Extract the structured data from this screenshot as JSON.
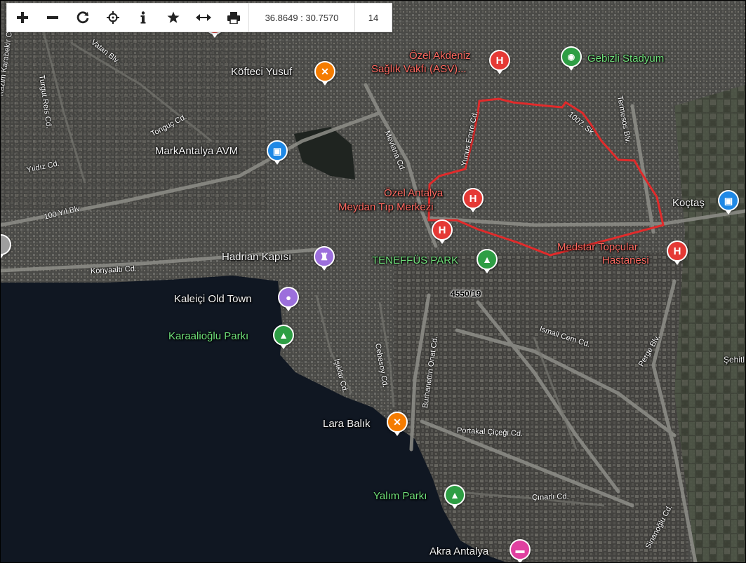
{
  "toolbar": {
    "buttons": [
      {
        "name": "zoom-in-button",
        "icon": "plus-icon"
      },
      {
        "name": "zoom-out-button",
        "icon": "minus-icon"
      },
      {
        "name": "refresh-button",
        "icon": "refresh-icon"
      },
      {
        "name": "locate-button",
        "icon": "crosshair-icon"
      },
      {
        "name": "info-button",
        "icon": "info-icon"
      },
      {
        "name": "favorite-button",
        "icon": "star-icon"
      },
      {
        "name": "measure-button",
        "icon": "arrows-horizontal-icon"
      },
      {
        "name": "print-button",
        "icon": "printer-icon"
      }
    ],
    "coordinates": "36.8649 : 30.7570",
    "zoom_level": "14"
  },
  "parcel_label": "4550/19",
  "colors": {
    "hospital": "#e53935",
    "restaurant": "#f57c00",
    "shopping": "#1e88e5",
    "park": "#2e9e44",
    "landmark": "#9c6fdc",
    "stadium": "#2e9e44",
    "hotel": "#e040a0",
    "boundary": "#e02b2b"
  },
  "places": {
    "ozel_akdeniz_1": "Özel Akdeniz",
    "ozel_akdeniz_2": "Sağlık Vakfı (ASV)...",
    "gebizli": "Gebizli Stadyum",
    "kofteci": "Köfteci Yusuf",
    "markantalya": "MarkAntalya AVM",
    "ozel_antalya_1": "Özel Antalya",
    "ozel_antalya_2": "Meydan Tıp Merkezi",
    "koctas": "Koçtaş",
    "hadrian": "Hadrian Kapısı",
    "teneffus": "TENEFFÜS PARK",
    "medstar_1": "Medstar Topçular",
    "medstar_2": "Hastanesi",
    "kaleici": "Kaleiçi Old Town",
    "karaalioglu": "Karaalioğlu Parkı",
    "lara_balik": "Lara Balık",
    "yalim": "Yalım Parkı",
    "akra": "Akra Antalya",
    "sehitler": "Şehitl"
  },
  "streets": {
    "vatan": "Vatan Blv.",
    "turgut_reis": "Turgut Reis Cd.",
    "kazim": "Kazım Karabekir Cd.",
    "tonguc": "Tonguç Cd.",
    "yildiz": "Yıldız Cd.",
    "yil100": "100 Yıl Blv.",
    "mevlana": "Mevlana Cd.",
    "yunus_emre": "Yunus Emre Cd.",
    "s1007": "1007. Sk.",
    "termesos": "Termesos Blv.",
    "konyaalti": "Konyaaltı Cd.",
    "burhanettin": "Burhanettin Onat Cd.",
    "cebesoy": "Cebesoy Cd.",
    "isiklar": "Işıklar Cd.",
    "ismail_cem": "İsmail Cem Cd.",
    "perge": "Perge Blv.",
    "portakal": "Portakal Çiçeği Cd.",
    "cinarli": "Çınarlı Cd.",
    "sinanoglu": "Sinanoğlu Cd."
  }
}
